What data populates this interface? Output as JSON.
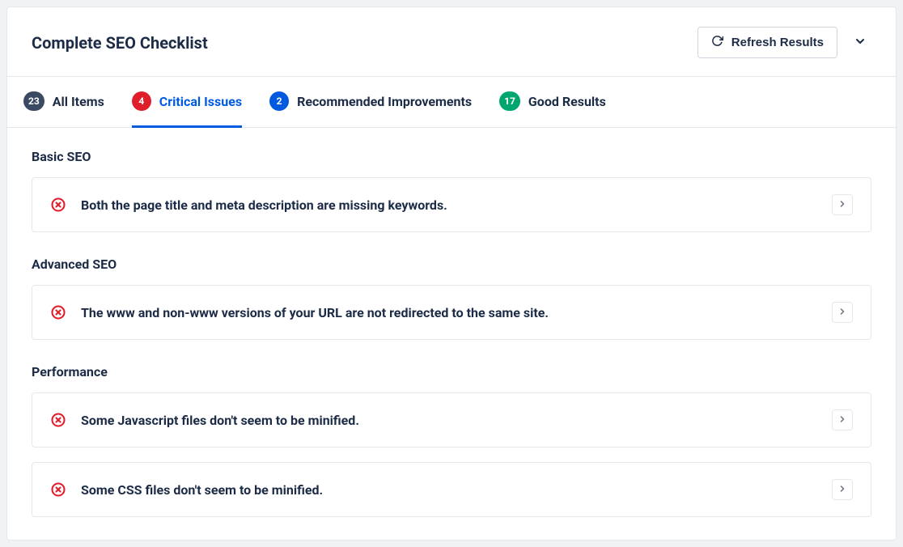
{
  "header": {
    "title": "Complete SEO Checklist",
    "refresh_label": "Refresh Results"
  },
  "tabs": [
    {
      "count": "23",
      "label": "All Items"
    },
    {
      "count": "4",
      "label": "Critical Issues"
    },
    {
      "count": "2",
      "label": "Recommended Improvements"
    },
    {
      "count": "17",
      "label": "Good Results"
    }
  ],
  "sections": [
    {
      "title": "Basic SEO",
      "items": [
        "Both the page title and meta description are missing keywords."
      ]
    },
    {
      "title": "Advanced SEO",
      "items": [
        "The www and non-www versions of your URL are not redirected to the same site."
      ]
    },
    {
      "title": "Performance",
      "items": [
        "Some Javascript files don't seem to be minified.",
        "Some CSS files don't seem to be minified."
      ]
    }
  ]
}
